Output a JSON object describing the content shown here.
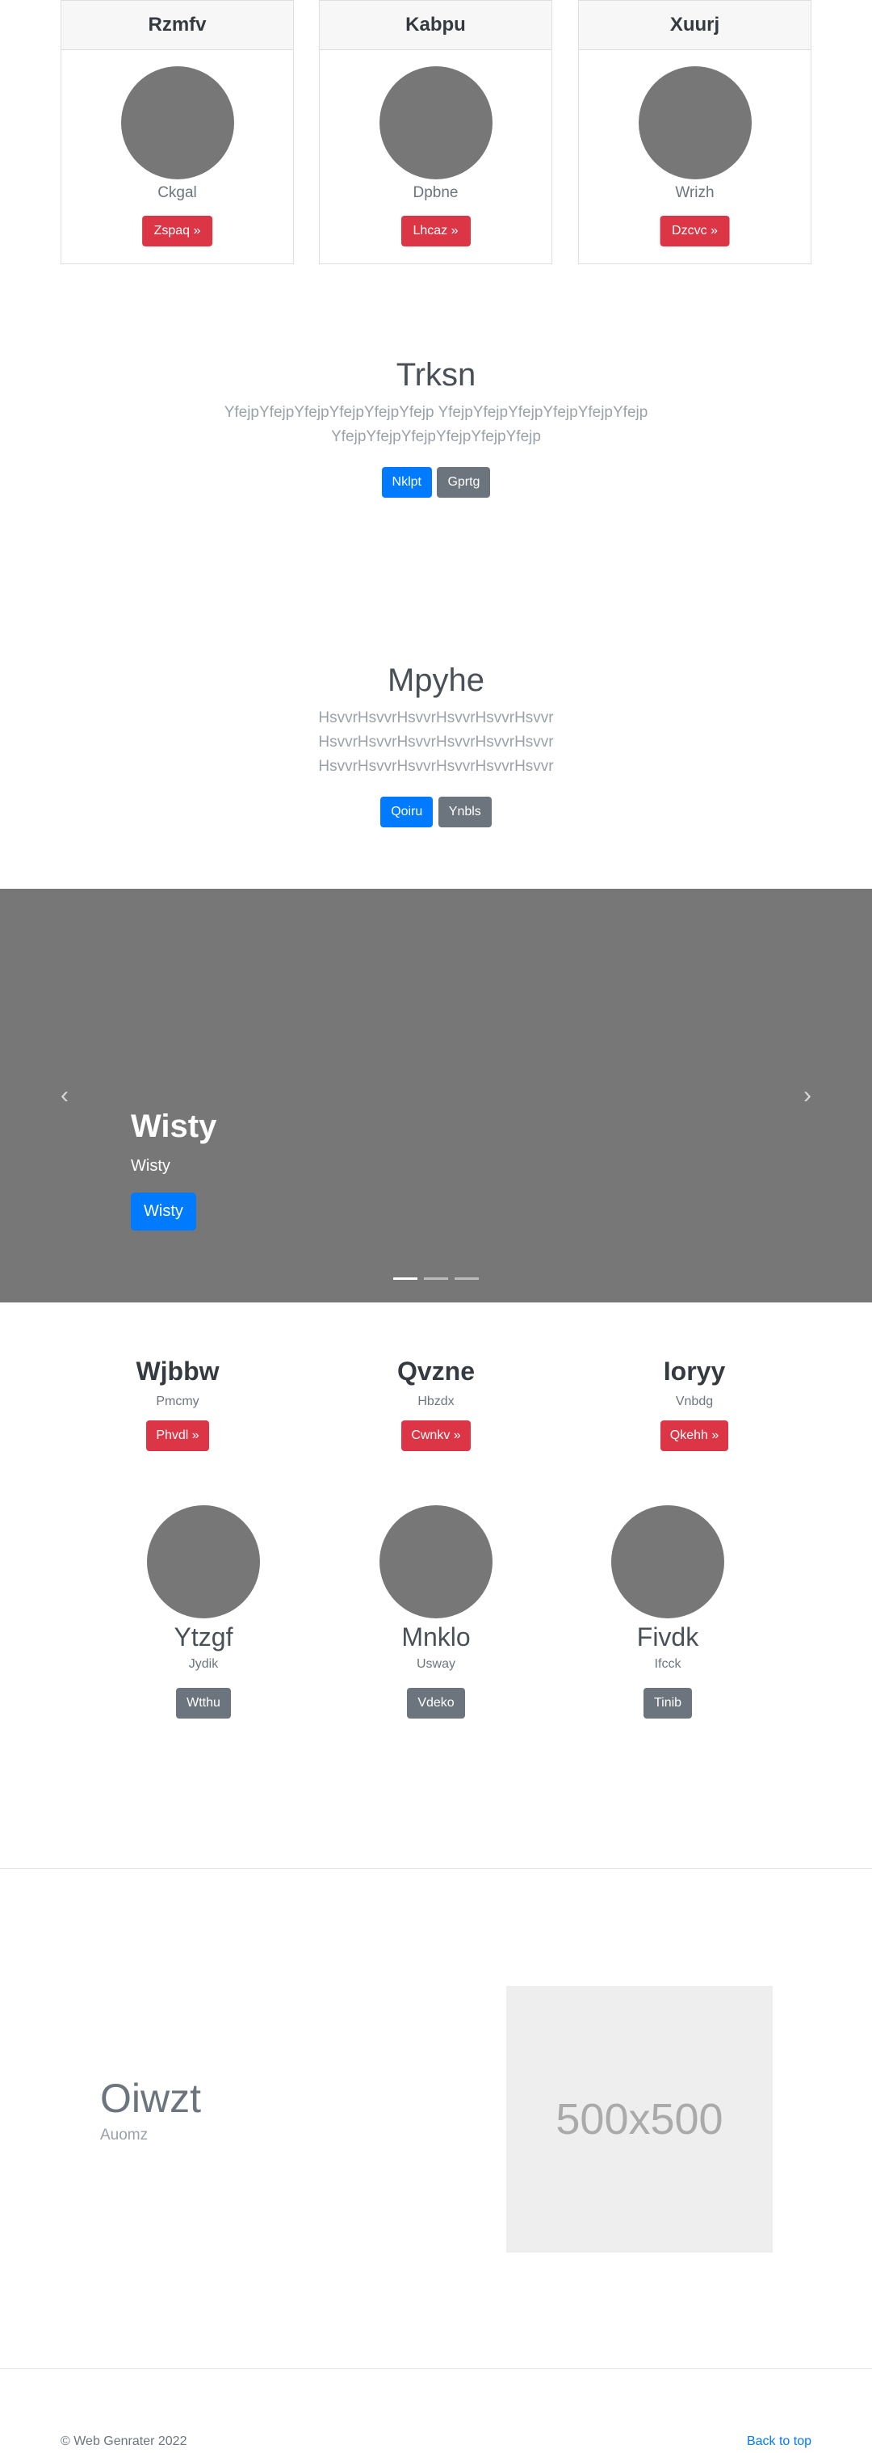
{
  "cards": [
    {
      "title": "Rzmfv",
      "text": "Ckgal",
      "button": "Zspaq »"
    },
    {
      "title": "Kabpu",
      "text": "Dpbne",
      "button": "Lhcaz »"
    },
    {
      "title": "Xuurj",
      "text": "Wrizh",
      "button": "Dzcvc »"
    }
  ],
  "hero1": {
    "title": "Trksn",
    "lead": "YfejpYfejpYfejpYfejpYfejpYfejp YfejpYfejpYfejpYfejpYfejpYfejp YfejpYfejpYfejpYfejpYfejpYfejp",
    "primary_button": "Nklpt",
    "secondary_button": "Gprtg"
  },
  "hero2": {
    "title": "Mpyhe",
    "lead": "HsvvrHsvvrHsvvrHsvvrHsvvrHsvvr HsvvrHsvvrHsvvrHsvvrHsvvrHsvvr HsvvrHsvvrHsvvrHsvvrHsvvrHsvvr",
    "primary_button": "Qoiru",
    "secondary_button": "Ynbls"
  },
  "carousel": {
    "title": "Wisty",
    "subtitle": "Wisty",
    "button": "Wisty",
    "prev_icon": "‹",
    "next_icon": "›",
    "slide_count": 3,
    "active_slide": 1
  },
  "columns": [
    {
      "title": "Wjbbw",
      "sub": "Pmcmy",
      "button": "Phvdl »"
    },
    {
      "title": "Qvzne",
      "sub": "Hbzdx",
      "button": "Cwnkv »"
    },
    {
      "title": "Ioryy",
      "sub": "Vnbdg",
      "button": "Qkehh »"
    }
  ],
  "people": [
    {
      "name": "Ytzgf",
      "sub": "Jydik",
      "button": "Wtthu"
    },
    {
      "name": "Mnklo",
      "sub": "Usway",
      "button": "Vdeko"
    },
    {
      "name": "Fivdk",
      "sub": "Ifcck",
      "button": "Tinib"
    }
  ],
  "featurette": {
    "title": "Oiwzt",
    "sub": "Auomz",
    "image_label": "500x500"
  },
  "footer": {
    "copyright": "© Web Genrater 2022",
    "back_to_top": "Back to top"
  },
  "colors": {
    "primary": "#007bff",
    "danger": "#dc3545",
    "secondary": "#6c757d",
    "placeholder": "#777777"
  }
}
